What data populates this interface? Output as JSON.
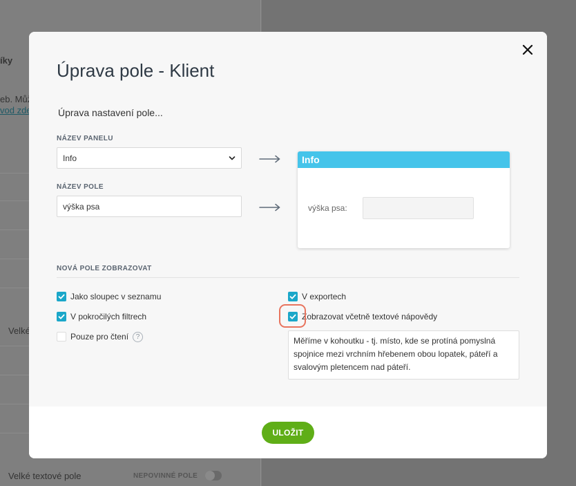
{
  "background": {
    "column_header_fragment": "íky",
    "text_fragment": "eb. Můž",
    "link_fragment": "vod zde",
    "row_label_fragment": "Velké",
    "bottom_row_label": "Velké textové pole",
    "bottom_row_badge": "NEPOVINNÉ POLE"
  },
  "modal": {
    "title": "Úprava pole - Klient",
    "subtitle": "Úprava nastavení pole...",
    "panel_name_label": "NÁZEV PANELU",
    "panel_name_value": "Info",
    "field_name_label": "NÁZEV POLE",
    "field_name_value": "výška psa",
    "preview": {
      "panel_title": "Info",
      "field_label": "výška psa:"
    },
    "display_section_label": "NOVÁ POLE ZOBRAZOVAT",
    "options": {
      "as_list_column": {
        "label": "Jako sloupec v seznamu",
        "checked": true
      },
      "in_exports": {
        "label": "V exportech",
        "checked": true
      },
      "in_advanced_filters": {
        "label": "V pokročilých filtrech",
        "checked": true
      },
      "with_help_text": {
        "label": "Zobrazovat včetně textové nápovědy",
        "checked": true
      },
      "read_only": {
        "label": "Pouze pro čtení",
        "checked": false
      }
    },
    "help_icon_glyph": "?",
    "help_text": "Měříme v kohoutku - tj. místo, kde se protíná pomyslná spojnice mezi vrchním hřebenem obou lopatek, páteří a svalovým pletencem nad páteří.",
    "save_label": "ULOŽIT"
  },
  "colors": {
    "accent_checkbox": "#1ba7c9",
    "preview_header": "#45c4ea",
    "save_button": "#5fae17",
    "highlight": "#e8745e"
  },
  "icons": {
    "close": "close-icon",
    "select_chevron": "chevron-down-icon",
    "arrow": "arrow-right-icon",
    "check": "check-icon",
    "help": "help-icon"
  }
}
